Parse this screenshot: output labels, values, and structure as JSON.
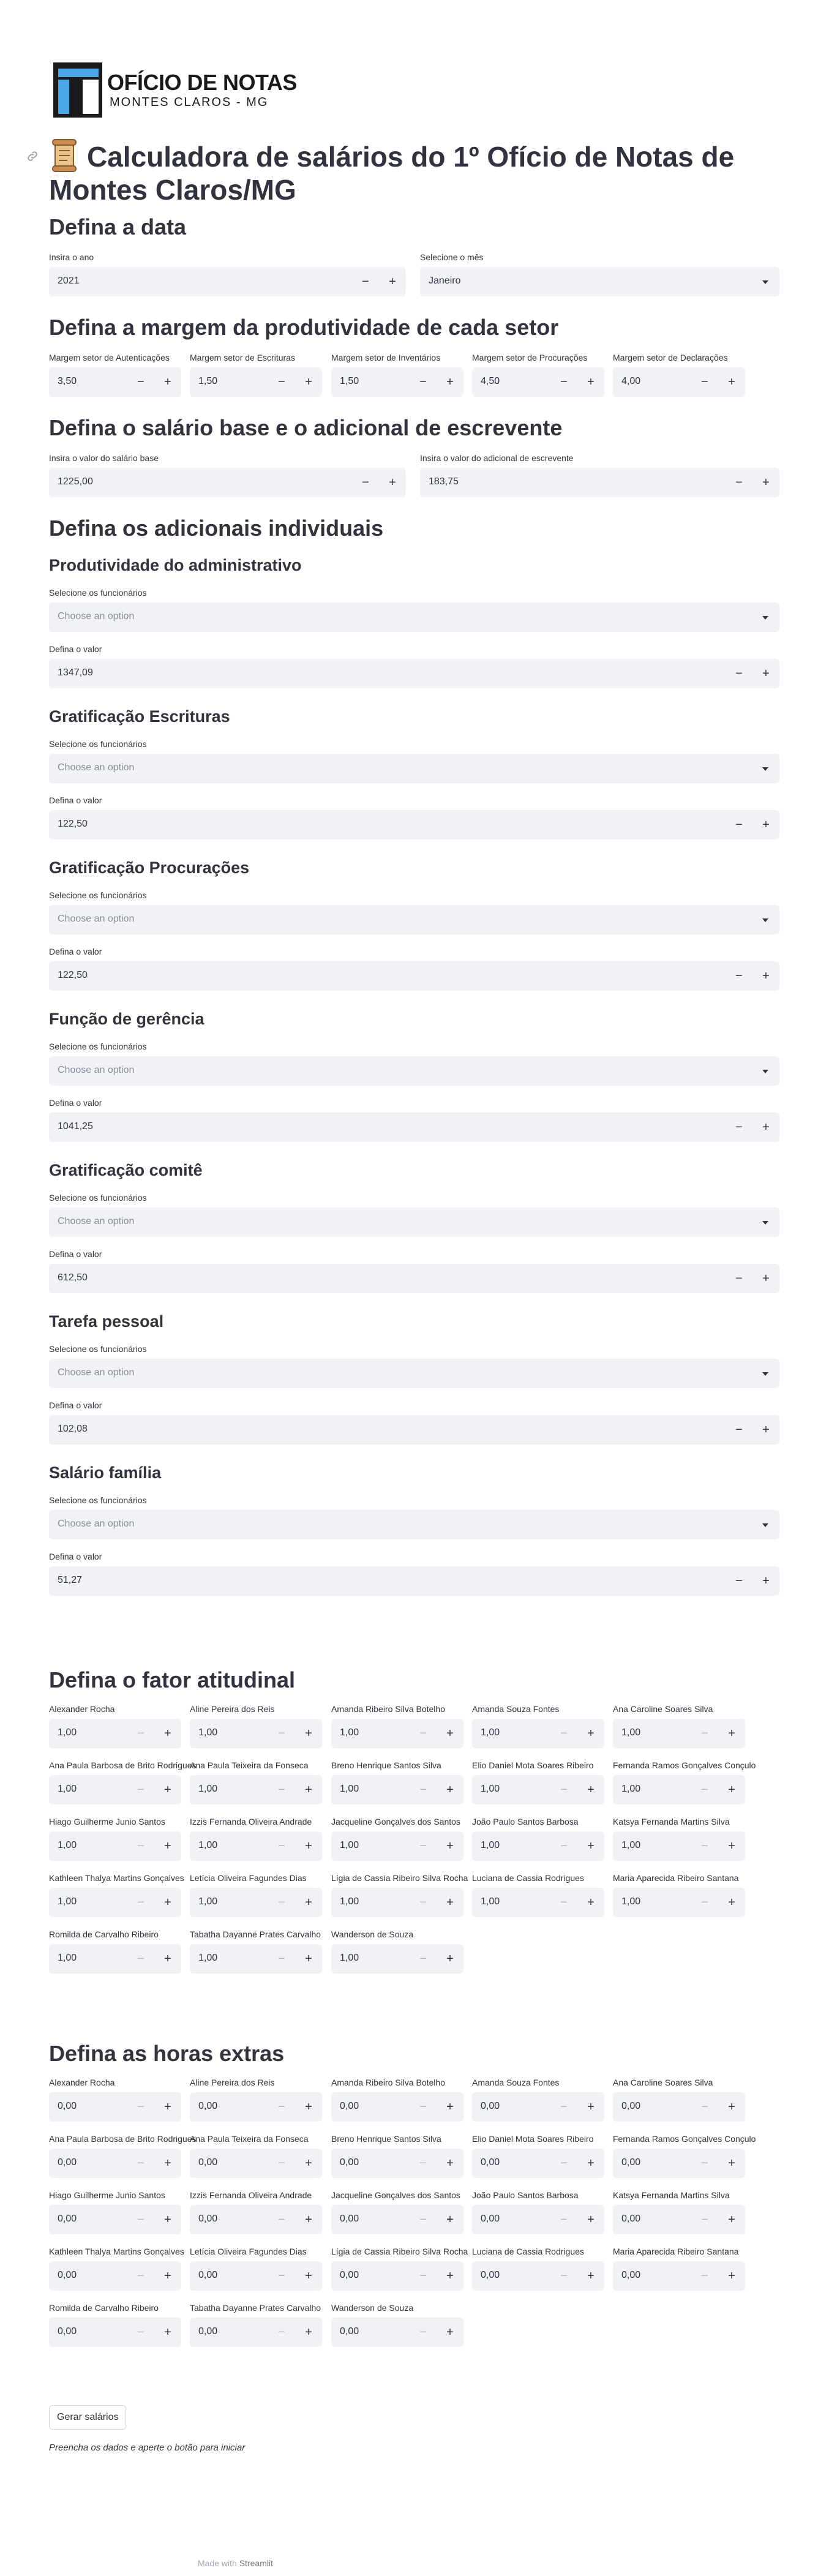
{
  "logo": {
    "title": "OFÍCIO DE NOTAS",
    "subtitle": "MONTES CLAROS - MG"
  },
  "page_title": "Calculadora de salários do 1º Ofício de Notas de Montes Claros/MG",
  "date_section": {
    "heading": "Defina a data",
    "year_label": "Insira o ano",
    "year_value": "2021",
    "month_label": "Selecione o mês",
    "month_value": "Janeiro"
  },
  "margin_section": {
    "heading": "Defina a margem da produtividade de cada setor",
    "fields": [
      {
        "label": "Margem setor de Autenticações",
        "value": "3,50"
      },
      {
        "label": "Margem setor de Escrituras",
        "value": "1,50"
      },
      {
        "label": "Margem setor de Inventários",
        "value": "1,50"
      },
      {
        "label": "Margem setor de Procurações",
        "value": "4,50"
      },
      {
        "label": "Margem setor de Declarações",
        "value": "4,00"
      }
    ]
  },
  "base_section": {
    "heading": "Defina o salário base e o adicional de escrevente",
    "base_label": "Insira o valor do salário base",
    "base_value": "1225,00",
    "add_label": "Insira o valor do adicional de escrevente",
    "add_value": "183,75"
  },
  "individual_section": {
    "heading": "Defina os adicionais individuais",
    "select_label": "Selecione os funcionários",
    "select_placeholder": "Choose an option",
    "value_label": "Defina o valor",
    "groups": [
      {
        "title": "Produtividade do administrativo",
        "value": "1347,09"
      },
      {
        "title": "Gratificação Escrituras",
        "value": "122,50"
      },
      {
        "title": "Gratificação Procurações",
        "value": "122,50"
      },
      {
        "title": "Função de gerência",
        "value": "1041,25"
      },
      {
        "title": "Gratificação comitê",
        "value": "612,50"
      },
      {
        "title": "Tarefa pessoal",
        "value": "102,08"
      },
      {
        "title": "Salário família",
        "value": "51,27"
      }
    ]
  },
  "employees": [
    "Alexander Rocha",
    "Aline Pereira dos Reis",
    "Amanda Ribeiro Silva Botelho",
    "Amanda Souza Fontes",
    "Ana Caroline Soares Silva",
    "Ana Paula Barbosa de Brito Rodrigues",
    "Ana Paula Teixeira da Fonseca",
    "Breno Henrique Santos Silva",
    "Elio Daniel Mota Soares Ribeiro",
    "Fernanda Ramos Gonçalves Conçulo",
    "Hiago Guilherme Junio Santos",
    "Izzis Fernanda Oliveira Andrade",
    "Jacqueline Gonçalves dos Santos",
    "João Paulo Santos Barbosa",
    "Katsya Fernanda Martins Silva",
    "Kathleen Thalya Martins Gonçalves",
    "Letícia Oliveira Fagundes Dias",
    "Lígia de Cassia Ribeiro Silva Rocha",
    "Luciana de Cassia Rodrigues",
    "Maria Aparecida Ribeiro Santana",
    "Romilda de Carvalho Ribeiro",
    "Tabatha Dayanne Prates Carvalho",
    "Wanderson de Souza"
  ],
  "attitude_section": {
    "heading": "Defina o fator atitudinal",
    "default_value": "1,00"
  },
  "overtime_section": {
    "heading": "Defina as horas extras",
    "default_value": "0,00"
  },
  "button": {
    "label": "Gerar salários"
  },
  "note": "Preencha os dados e aperte o botão para iniciar",
  "footer": {
    "prefix": "Made with ",
    "brand": "Streamlit"
  },
  "icons": {
    "link": "link-icon",
    "scroll": "scroll-icon",
    "minus": "−",
    "plus": "+"
  },
  "colors": {
    "field_bg": "#f0f2f6",
    "text": "#31333f",
    "logo_blue": "#4aa8e8"
  }
}
